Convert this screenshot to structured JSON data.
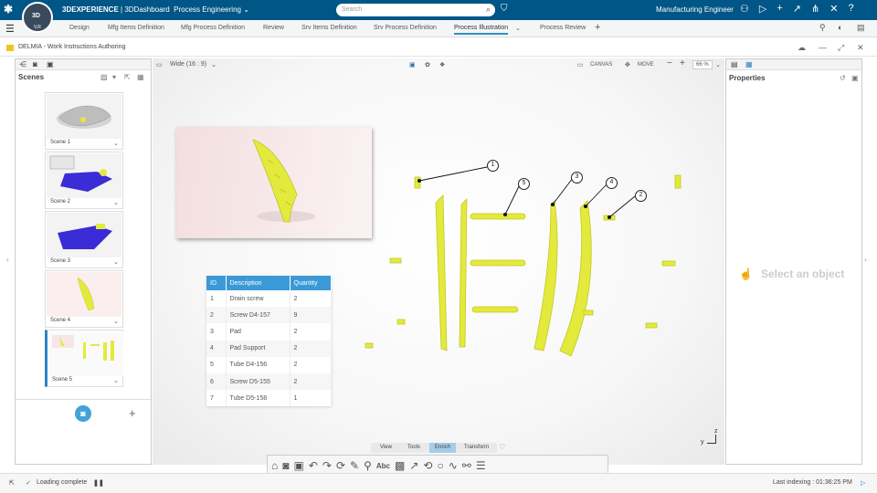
{
  "app": {
    "brand_name": "3DEXPERIENCE",
    "brand_sep": " | 3DDashboard",
    "dashboard": "Process Engineering",
    "compass_label": "3D",
    "compass_version": "V,R",
    "search_placeholder": "Search",
    "user_role": "Manufacturing Engineer"
  },
  "tabs": [
    {
      "label": "Design"
    },
    {
      "label": "Mfg Items Definition"
    },
    {
      "label": "Mfg Process Definition"
    },
    {
      "label": "Review"
    },
    {
      "label": "Srv Items Definition"
    },
    {
      "label": "Srv Process Definition"
    },
    {
      "label": "Process Illustration",
      "active": true
    },
    {
      "label": "Process Review"
    }
  ],
  "window_title": "DELMIA - Work Instructions Authoring",
  "left_panel": {
    "title": "Scenes",
    "scenes": [
      {
        "label": "Scene 1"
      },
      {
        "label": "Scene 2"
      },
      {
        "label": "Scene 3"
      },
      {
        "label": "Scene 4"
      },
      {
        "label": "Scene 5",
        "selected": true
      }
    ]
  },
  "viewport": {
    "aspect": "Wide (16 : 9)",
    "canvas_label": "CANVAS",
    "move_label": "MOVE",
    "zoom": "66 %",
    "callouts": [
      "1",
      "2",
      "3",
      "4",
      "5"
    ],
    "menu": [
      "View",
      "Tools",
      "Enrich",
      "Transform"
    ],
    "active_menu": "Enrich",
    "axis_y": "y",
    "axis_z": "z"
  },
  "bom_table": {
    "headers": [
      "ID",
      "Description",
      "Quantity"
    ],
    "rows": [
      [
        "1",
        "Drain screw",
        "2"
      ],
      [
        "2",
        "Screw D4-157",
        "9"
      ],
      [
        "3",
        "Pad",
        "2"
      ],
      [
        "4",
        "Pad Support",
        "2"
      ],
      [
        "5",
        "Tube D4-156",
        "2"
      ],
      [
        "6",
        "Screw D5-155",
        "2"
      ],
      [
        "7",
        "Tube D5-158",
        "1"
      ]
    ]
  },
  "right_panel": {
    "title": "Properties",
    "empty_message": "Select an object"
  },
  "status": {
    "loading": "Loading complete",
    "indexing": "Last indexing : 01:36:25 PM"
  },
  "colors": {
    "topbar": "#005686",
    "accent": "#368ec4",
    "table_header": "#3b9ad6",
    "part_yellow": "#e4ea3c"
  }
}
